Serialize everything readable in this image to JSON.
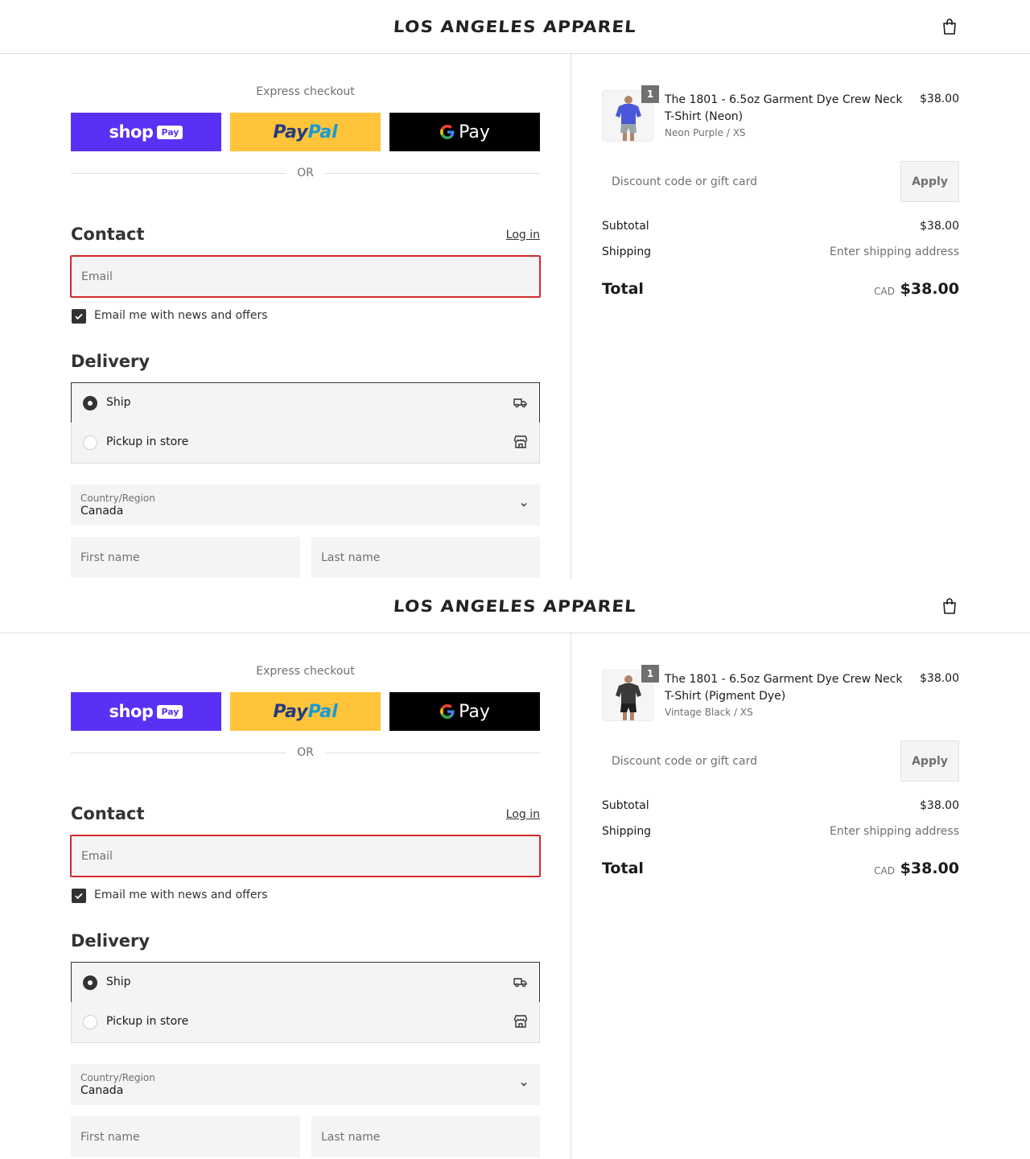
{
  "brand": "LOS ANGELES APPAREL",
  "express_title": "Express checkout",
  "wallets": {
    "shop": "shop",
    "shop_pay": "Pay",
    "paypal_pay": "Pay",
    "paypal_pal": "Pal",
    "gpay_g": "G",
    "gpay_word": "Pay"
  },
  "or_text": "OR",
  "contact": {
    "heading": "Contact",
    "login": "Log in",
    "email_placeholder": "Email",
    "newsletter_label": "Email me with news and offers",
    "newsletter_checked": true
  },
  "delivery": {
    "heading": "Delivery",
    "options": [
      {
        "label": "Ship",
        "selected": true,
        "icon": "truck-icon"
      },
      {
        "label": "Pickup in store",
        "selected": false,
        "icon": "store-icon"
      }
    ],
    "country_label": "Country/Region",
    "country_value": "Canada",
    "first_name_placeholder": "First name",
    "last_name_placeholder": "Last name"
  },
  "summary": {
    "discount_placeholder": "Discount code or gift card",
    "apply": "Apply",
    "subtotal_label": "Subtotal",
    "subtotal": "$38.00",
    "shipping_label": "Shipping",
    "shipping": "Enter shipping address",
    "total_label": "Total",
    "currency": "CAD",
    "total": "$38.00"
  },
  "panels": [
    {
      "product": {
        "name": "The 1801 - 6.5oz Garment Dye Crew Neck T-Shirt (Neon)",
        "variant": "Neon Purple / XS",
        "price": "$38.00",
        "quantity": "1",
        "shirt_color": "#4a57d8",
        "shorts_color": "#9aa3a8"
      }
    },
    {
      "product": {
        "name": "The 1801 - 6.5oz Garment Dye Crew Neck T-Shirt (Pigment Dye)",
        "variant": "Vintage Black / XS",
        "price": "$38.00",
        "quantity": "1",
        "shirt_color": "#3a3a3a",
        "shorts_color": "#1e1e1e"
      }
    }
  ],
  "colors": {
    "shop_purple": "#5a31f4",
    "paypal_yellow": "#ffc439",
    "error_red": "#d52b2b"
  }
}
